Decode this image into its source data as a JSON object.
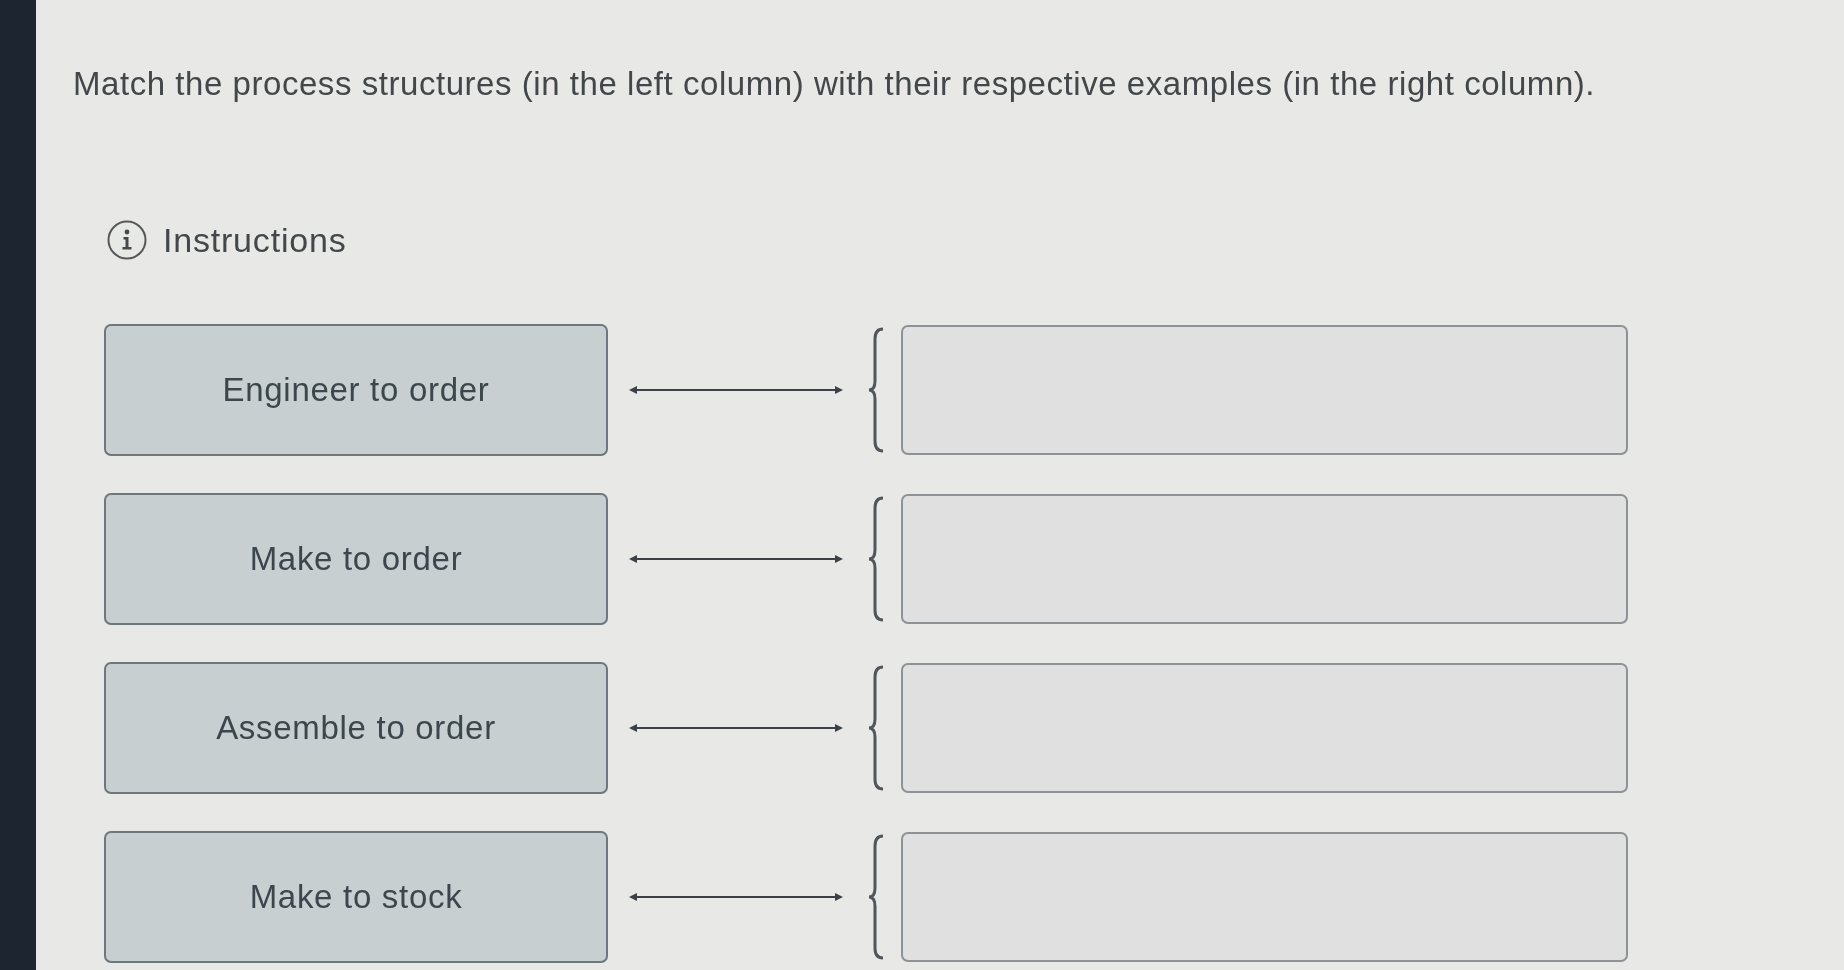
{
  "prompt": "Match the process structures (in the left column) with their respective examples (in the right column).",
  "instructions": {
    "label": "Instructions"
  },
  "pairs": [
    {
      "item": "Engineer to order"
    },
    {
      "item": "Make to order"
    },
    {
      "item": "Assemble to order"
    },
    {
      "item": "Make to stock"
    }
  ]
}
